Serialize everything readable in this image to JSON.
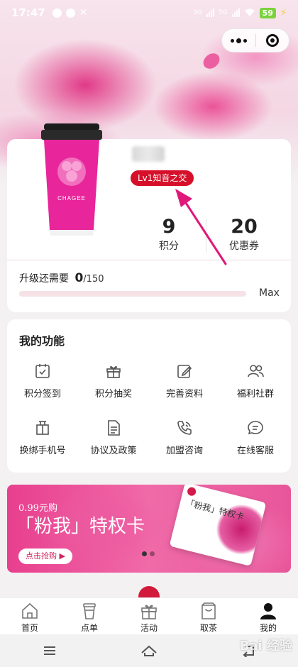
{
  "status_bar": {
    "time": "17:47",
    "network1": "3G",
    "network2": "5G",
    "battery": "59"
  },
  "member": {
    "level": "Lv1知音之交",
    "points_value": "9",
    "points_label": "积分",
    "coupons_value": "20",
    "coupons_label": "优惠券",
    "upgrade_label": "升级还需要",
    "upgrade_current": "0",
    "upgrade_total": "/150",
    "upgrade_progress": 0,
    "max_label": "Max",
    "cup_brand": "CHAGEE"
  },
  "functions": {
    "title": "我的功能",
    "items": [
      {
        "label": "积分签到",
        "icon": "calendar-check-icon"
      },
      {
        "label": "积分抽奖",
        "icon": "gift-icon"
      },
      {
        "label": "完善资料",
        "icon": "edit-icon"
      },
      {
        "label": "福利社群",
        "icon": "users-icon"
      },
      {
        "label": "换绑手机号",
        "icon": "phone-swap-icon"
      },
      {
        "label": "协议及政策",
        "icon": "document-icon"
      },
      {
        "label": "加盟咨询",
        "icon": "phone-call-icon"
      },
      {
        "label": "在线客服",
        "icon": "chat-icon"
      }
    ]
  },
  "banner": {
    "subtitle": "0.99元购",
    "title": "「粉我」特权卡",
    "button": "点击抢购 ▶",
    "card_text": "「粉我」特权卡",
    "dots": 2,
    "active_dot": 1
  },
  "tabs": [
    {
      "label": "首页",
      "icon": "home-icon"
    },
    {
      "label": "点单",
      "icon": "cup-icon"
    },
    {
      "label": "活动",
      "icon": "gift-icon"
    },
    {
      "label": "取茶",
      "icon": "bag-icon"
    },
    {
      "label": "我的",
      "icon": "user-icon",
      "active": true
    }
  ],
  "watermark": "Bai 经验",
  "colors": {
    "accent": "#d6102a",
    "brand_pink": "#e8449a",
    "progress_track": "#f5e1e6",
    "annotation": "#e0187a"
  }
}
